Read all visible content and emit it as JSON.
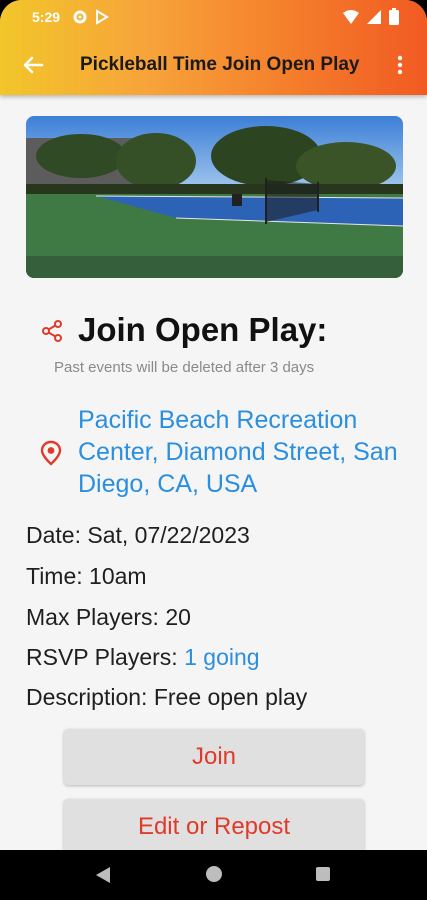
{
  "status": {
    "time": "5:29"
  },
  "appbar": {
    "title": "Pickleball Time Join Open Play"
  },
  "event": {
    "heading": "Join Open Play:",
    "note": "Past events will be deleted after 3 days",
    "location": "Pacific Beach Recreation Center, Diamond Street, San Diego, CA, USA",
    "date": "Date: Sat, 07/22/2023",
    "time": "Time: 10am",
    "max_players": "Max Players: 20",
    "rsvp_label": "RSVP Players: ",
    "rsvp_value": "1 going",
    "description": "Description: Free open play"
  },
  "buttons": {
    "join": "Join",
    "edit": "Edit or Repost"
  },
  "colors": {
    "accent_red": "#e23a2a",
    "link_blue": "#2b8fe0",
    "appbar_gradient_start": "#f2c62a",
    "appbar_gradient_end": "#f15a22"
  }
}
